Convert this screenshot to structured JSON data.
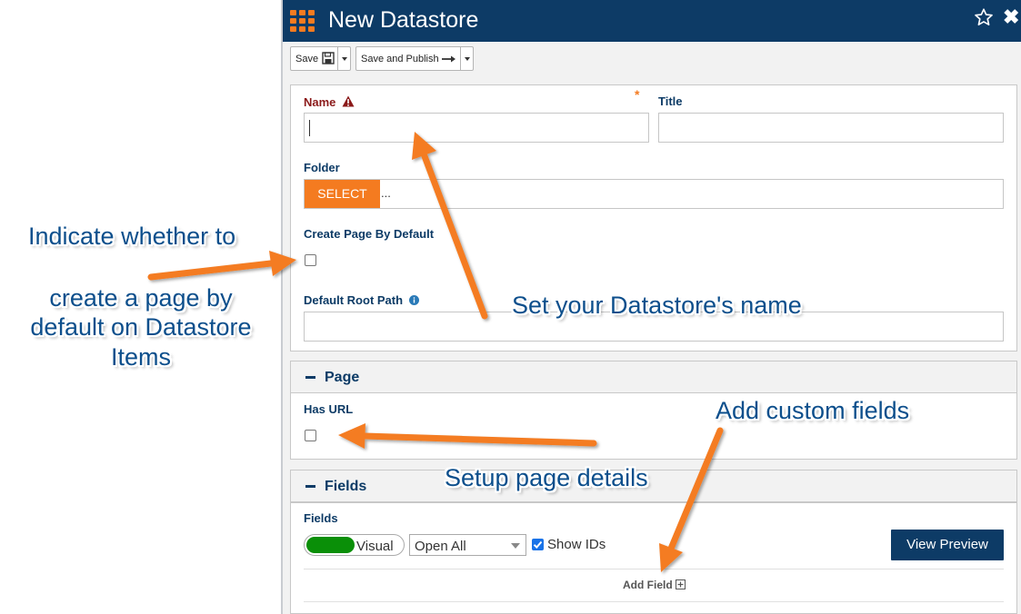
{
  "header": {
    "title": "New Datastore"
  },
  "toolbar": {
    "save_label": "Save",
    "publish_label": "Save and Publish"
  },
  "form": {
    "name_label": "Name",
    "title_label": "Title",
    "required_mark": "*",
    "folder_label": "Folder",
    "select_button": "SELECT",
    "folder_value": "...",
    "create_page_label": "Create Page By Default",
    "root_path_label": "Default Root Path",
    "create_page_checked": false
  },
  "page_section": {
    "heading": "Page",
    "has_url_label": "Has URL",
    "has_url_checked": false
  },
  "fields_section": {
    "heading": "Fields",
    "fields_label": "Fields",
    "toggle_label": "Visual",
    "open_all_value": "Open All",
    "show_ids_label": "Show IDs",
    "show_ids_checked": true,
    "view_preview": "View Preview",
    "add_field": "Add Field"
  },
  "annotations": {
    "create_page_line1": "Indicate whether to",
    "create_page_line2": "create a page by",
    "create_page_line3": "default on Datastore",
    "create_page_line4": "Items",
    "name": "Set your Datastore's name",
    "custom_fields": "Add custom fields",
    "page_details": "Setup page details"
  },
  "colors": {
    "header": "#0d3b66",
    "accent": "#f47b20",
    "toggle_green": "#0a8f08",
    "label": "#0d3b66",
    "required": "#8b1a1a",
    "annotation": "#0d4f8c"
  }
}
